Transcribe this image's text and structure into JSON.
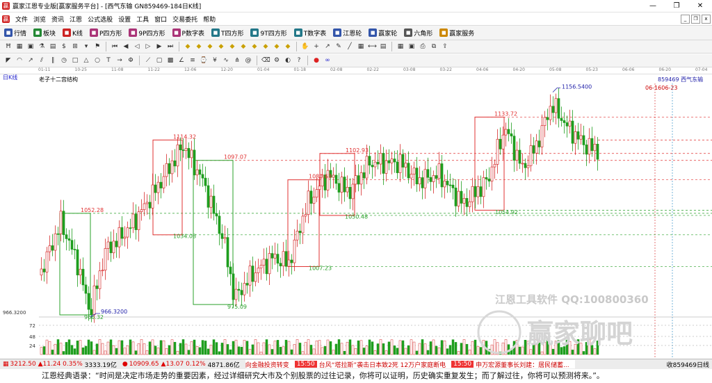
{
  "window": {
    "title": "赢家江恩专业版[赢家服务平台] - [西气东输  GN859469-184日K线]",
    "minimize": "—",
    "restore": "❐",
    "close": "✕"
  },
  "menu": {
    "items": [
      "文件",
      "浏览",
      "资讯",
      "江恩",
      "公式选股",
      "设置",
      "工具",
      "窗口",
      "交易委托",
      "帮助"
    ],
    "mdi_min": "_",
    "mdi_restore": "❐",
    "mdi_close": "x"
  },
  "toolbar1": [
    {
      "label": "行情",
      "icon": "grid-icon",
      "color": "#3355aa"
    },
    {
      "label": "板块",
      "icon": "blocks-icon",
      "color": "#228833"
    },
    {
      "label": "K线",
      "icon": "candlestick-icon",
      "color": "#cc2222"
    },
    {
      "label": "P四方形",
      "icon": "p-square-icon",
      "color": "#aa3377"
    },
    {
      "label": "9P四方形",
      "icon": "9p-square-icon",
      "color": "#aa3377"
    },
    {
      "label": "P数字表",
      "icon": "p-table-icon",
      "color": "#aa3377"
    },
    {
      "label": "T四方形",
      "icon": "t-square-icon",
      "color": "#227788"
    },
    {
      "label": "9T四方形",
      "icon": "9t-square-icon",
      "color": "#227788"
    },
    {
      "label": "T数字表",
      "icon": "t-table-icon",
      "color": "#227788"
    },
    {
      "label": "江恩轮",
      "icon": "gann-wheel-icon",
      "color": "#3355aa"
    },
    {
      "label": "赢家轮",
      "icon": "winner-wheel-icon",
      "color": "#3355aa"
    },
    {
      "label": "六角形",
      "icon": "hexagon-icon",
      "color": "#555555"
    },
    {
      "label": "赢家服务",
      "icon": "service-icon",
      "color": "#cc8800"
    }
  ],
  "toolbar2_icons": [
    "h-icon",
    "pattern-icon",
    "square-icon",
    "flask-icon",
    "bars-icon",
    "dollar-icon",
    "chart-icon",
    "dropdown-icon",
    "flag-icon",
    "first-icon",
    "prev-icon",
    "back-icon",
    "forward-icon",
    "next-icon",
    "last-icon",
    "diamond-a-icon",
    "diamond-b-icon",
    "diamond-c-icon",
    "diamond-d-icon",
    "diamond-e-icon",
    "diamond-f-icon",
    "diamond-g-icon",
    "diamond-h-icon",
    "diamond-i-icon",
    "diamond-j-icon",
    "hand-icon",
    "cross-icon",
    "arrow-icon",
    "palette-icon",
    "line-tool-icon",
    "grid-tool-icon",
    "measure-icon",
    "table-icon",
    "calendar-icon",
    "save-icon",
    "print-icon",
    "copy-icon",
    "export-icon"
  ],
  "toolbar3_icons": [
    "fan-icon",
    "arc-icon",
    "ray-icon",
    "channel-icon",
    "parallel-icon",
    "cycle-icon",
    "square-tool-icon",
    "triangle-icon",
    "ellipse-icon",
    "text-tool-icon",
    "arrow-tool-icon",
    "fib-icon",
    "gann-fan-icon",
    "gann-box-icon",
    "gann-square-icon",
    "angle-icon",
    "speed-icon",
    "time-icon",
    "price-icon",
    "wave-icon",
    "pitchfork-icon",
    "spiral-icon",
    "erase-icon",
    "settings-tool-icon",
    "color-tool-icon",
    "help-tool-icon",
    "apple-icon",
    "infinity-icon"
  ],
  "date_axis": [
    "01-11",
    "10-25",
    "11-08",
    "11-22",
    "12-06",
    "12-20",
    "01-04",
    "01-18",
    "02-08",
    "02-22",
    "03-08",
    "03-22",
    "04-06",
    "04-20",
    "05-08",
    "05-23",
    "06-06",
    "06-20",
    "07-04"
  ],
  "chart_labels": {
    "period": "日K线",
    "structure": "老子十二宫结构",
    "security": "859469  西气东输",
    "date_marker": "06-1606-23",
    "watermark_title": "江恩工具软件  QQ:100800360",
    "watermark_brand": "赢家聊吧",
    "axis_left_label": "966.3200"
  },
  "chart_data": {
    "type": "candlestick",
    "price_levels": [
      1156.54,
      1133.72,
      1114.32,
      1102.93,
      1097.07,
      1080.63,
      1052.28,
      1054.92,
      1050.48,
      1034.08,
      1007.23,
      975.09,
      966.32
    ],
    "annotations": [
      {
        "text": "1156.5400",
        "value": 1156.54
      },
      {
        "text": "1133.72",
        "value": 1133.72
      },
      {
        "text": "1114.32",
        "value": 1114.32
      },
      {
        "text": "1102.93",
        "value": 1102.93
      },
      {
        "text": "1097.07",
        "value": 1097.07
      },
      {
        "text": "1080.63",
        "value": 1080.63
      },
      {
        "text": "1052.28",
        "value": 1052.28
      },
      {
        "text": "1054.92",
        "value": 1054.92
      },
      {
        "text": "1050.48",
        "value": 1050.48
      },
      {
        "text": "1034.08",
        "value": 1034.08
      },
      {
        "text": "1007.23",
        "value": 1007.23
      },
      {
        "text": "975.09",
        "value": 975.09
      },
      {
        "text": "966.32",
        "value": 966.32
      },
      {
        "text": "966.3200",
        "value": 966.32
      }
    ],
    "volume_axis_ticks": [
      "72",
      "48",
      "24"
    ],
    "colors": {
      "up": "#d62c2c",
      "down": "#1e9e1e",
      "box_red": "#e03030",
      "box_green": "#2aa02a"
    }
  },
  "footer": {
    "sh_index": "3212.50",
    "sh_change": "▲11.24",
    "sh_pct": "0.35%",
    "sh_vol": "3333.19亿",
    "sz_index": "10909.65",
    "sz_change": "▲13.07",
    "sz_pct": "0.12%",
    "sz_vol": "4871.86亿",
    "news": [
      {
        "time": "",
        "text": "向金融投资转变"
      },
      {
        "time": "15:50",
        "text": "台风“塔拉斯”袭击日本致2死 12万户家庭断电"
      },
      {
        "time": "15:50",
        "text": "申万宏源董事长刘建：居民储蓄..."
      }
    ],
    "right_tag": "收859469日线"
  },
  "quote": "江恩经典语录：“时间是决定市场走势的重要因素，经过详细研究大市及个别股票的过往记录，你将可以证明，历史确实重复发生；而了解过往，你将可以预测将来。”。"
}
